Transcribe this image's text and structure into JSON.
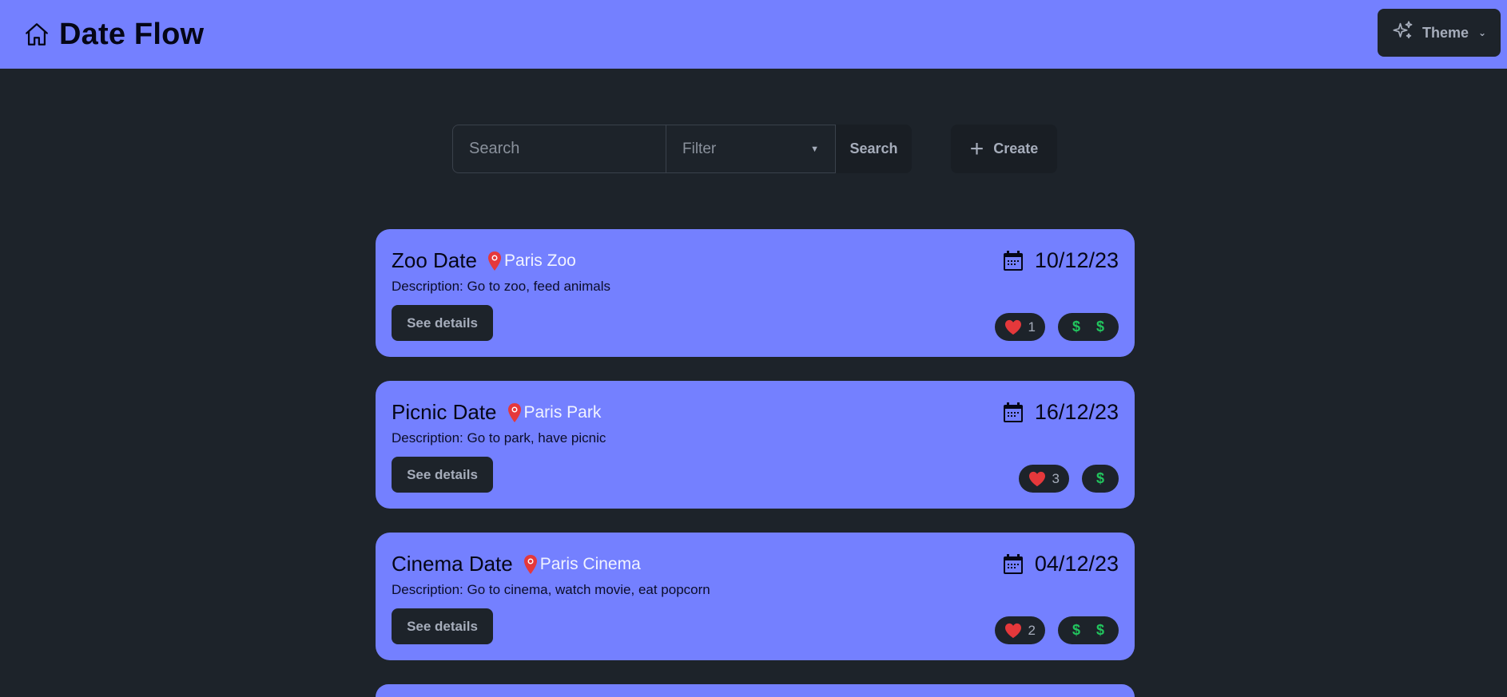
{
  "header": {
    "title": "Date Flow",
    "theme_label": "Theme"
  },
  "search": {
    "placeholder": "Search",
    "filter_placeholder": "Filter",
    "search_label": "Search",
    "create_label": "Create"
  },
  "cards": [
    {
      "title": "Zoo Date",
      "location": "Paris Zoo",
      "date": "10/12/23",
      "description": "Description: Go to zoo, feed animals",
      "details_label": "See details",
      "likes": "1",
      "price_level": 2
    },
    {
      "title": "Picnic Date",
      "location": "Paris Park",
      "date": "16/12/23",
      "description": "Description: Go to park, have picnic",
      "details_label": "See details",
      "likes": "3",
      "price_level": 1
    },
    {
      "title": "Cinema Date",
      "location": "Paris Cinema",
      "date": "04/12/23",
      "description": "Description: Go to cinema, watch movie, eat popcorn",
      "details_label": "See details",
      "likes": "2",
      "price_level": 2
    }
  ],
  "colors": {
    "primary": "#7480ff",
    "background": "#1d232a",
    "heart": "#e5383b",
    "pin": "#e5383b",
    "price": "#22c55e"
  },
  "icons": {
    "brand": "home-icon",
    "theme": "sparkles-icon",
    "create": "plus-icon",
    "location": "map-pin-icon",
    "date": "calendar-icon",
    "likes": "heart-icon",
    "price": "dollar-icon"
  }
}
